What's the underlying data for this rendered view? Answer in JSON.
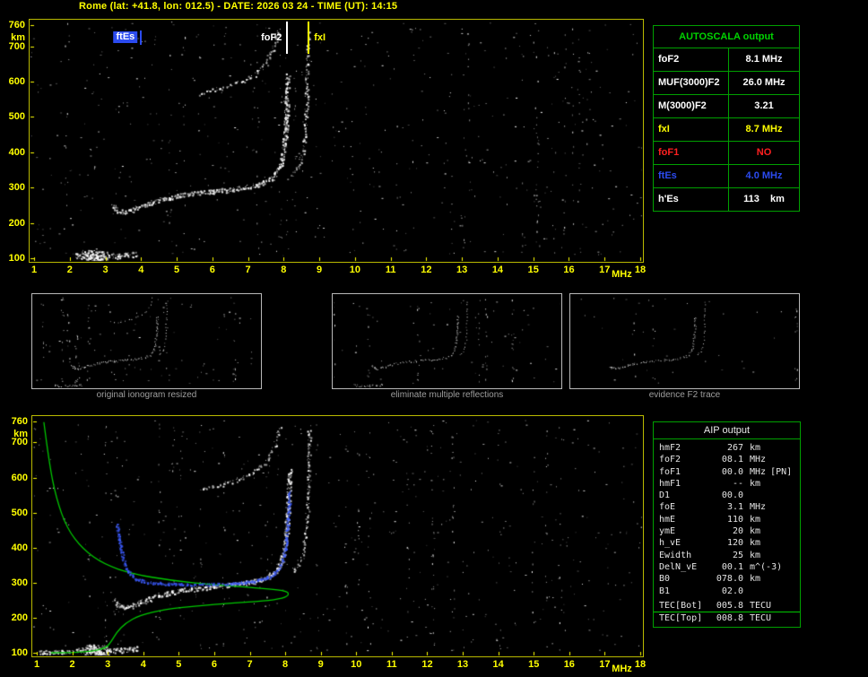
{
  "title": "Rome (lat: +41.8, lon: 012.5) - DATE: 2026 03 24 - TIME (UT): 14:15",
  "colors": {
    "axis": "#ffff00",
    "border_yellow": "#b9b900",
    "border_green": "#00a000",
    "header_green": "#00d400",
    "trace_white": "#ffffff",
    "profile_green": "#00c800",
    "restored_blue": "#3c5cff",
    "ftes_blue": "#2b4bf0",
    "fof1_red": "#ff2020",
    "fxi_yellow": "#ffff00",
    "caption_gray": "#9f9f9f"
  },
  "autoscala": {
    "header": "AUTOSCALA output",
    "rows": [
      {
        "label": "foF2",
        "value": "8.1 MHz",
        "color": "#ffffff"
      },
      {
        "label": "MUF(3000)F2",
        "value": "26.0 MHz",
        "color": "#ffffff"
      },
      {
        "label": "M(3000)F2",
        "value": "3.21",
        "color": "#ffffff"
      },
      {
        "label": "fxI",
        "value": "8.7 MHz",
        "color": "#ffff00"
      },
      {
        "label": "foF1",
        "value": "NO",
        "color": "#ff2020"
      },
      {
        "label": "ftEs",
        "value": "4.0 MHz",
        "color": "#2b4bf0"
      },
      {
        "label": "h'Es",
        "value": "113    km",
        "color": "#ffffff"
      }
    ]
  },
  "aip": {
    "header": "AIP output",
    "rows": [
      {
        "label": "hmF2",
        "value": "267",
        "unit": "km",
        "extra": ""
      },
      {
        "label": "foF2",
        "value": "08.1",
        "unit": "MHz",
        "extra": ""
      },
      {
        "label": "foF1",
        "value": "00.0",
        "unit": "MHz",
        "extra": "[PN]"
      },
      {
        "label": "hmF1",
        "value": "--",
        "unit": "km",
        "extra": ""
      },
      {
        "label": "D1",
        "value": "00.0",
        "unit": "",
        "extra": ""
      },
      {
        "label": "foE",
        "value": "3.1",
        "unit": "MHz",
        "extra": ""
      },
      {
        "label": "hmE",
        "value": "110",
        "unit": "km",
        "extra": ""
      },
      {
        "label": "ymE",
        "value": "20",
        "unit": "km",
        "extra": ""
      },
      {
        "label": "h_vE",
        "value": "120",
        "unit": "km",
        "extra": ""
      },
      {
        "label": "Ewidth",
        "value": "25",
        "unit": "km",
        "extra": ""
      },
      {
        "label": "DelN_vE",
        "value": "00.1",
        "unit": "m^(-3)",
        "extra": ""
      },
      {
        "label": "B0",
        "value": "078.0",
        "unit": "km",
        "extra": ""
      },
      {
        "label": "B1",
        "value": "02.0",
        "unit": "",
        "extra": ""
      }
    ],
    "tec_rows": [
      {
        "label": "TEC[Bot]",
        "value": "005.8",
        "unit": "TECU"
      },
      {
        "label": "TEC[Top]",
        "value": "008.8",
        "unit": "TECU"
      }
    ]
  },
  "captions": [
    "original ionogram resized",
    "eliminate multiple reflections",
    "evidence F2 trace"
  ],
  "chart_data": {
    "type": "scatter",
    "description": "Ionogram: echo virtual height (km) vs sounding frequency (MHz), with Autoscala scaled traces",
    "x_axis": {
      "label": "MHz",
      "min": 1,
      "max": 18,
      "ticks": [
        1,
        2,
        3,
        4,
        5,
        6,
        7,
        8,
        9,
        10,
        11,
        12,
        13,
        14,
        15,
        16,
        17,
        18
      ]
    },
    "y_axis": {
      "label": "km",
      "min": 100,
      "max": 760,
      "ticks": [
        760,
        700,
        600,
        500,
        400,
        300,
        200,
        100
      ]
    },
    "markers": [
      {
        "name": "ftEs",
        "label": "ftEs",
        "freq": 4.0,
        "color": "#2b4bf0",
        "text": "#ffffff",
        "filled": true,
        "side": "left"
      },
      {
        "name": "foF2",
        "label": "foF2",
        "freq": 8.1,
        "color": "#ffffff",
        "text": "#ffffff",
        "filled": false,
        "side": "left"
      },
      {
        "name": "fxI",
        "label": "fxI",
        "freq": 8.7,
        "color": "#ffff00",
        "text": "#ffff00",
        "filled": false,
        "side": "right"
      }
    ],
    "traces": {
      "es": {
        "points": [
          [
            2.15,
            110
          ],
          [
            2.45,
            106
          ],
          [
            2.75,
            104
          ],
          [
            3.05,
            106
          ],
          [
            3.35,
            108
          ],
          [
            3.6,
            110
          ],
          [
            3.85,
            113
          ]
        ],
        "jx": 2.5,
        "jy": 3,
        "passes": 2,
        "step": 1.2
      },
      "es_core": {
        "points": [
          [
            2.4,
            108
          ],
          [
            2.7,
            105
          ],
          [
            3.0,
            107
          ]
        ],
        "jx": 4,
        "jy": 7,
        "passes": 4,
        "step": 0.8
      },
      "es_low": {
        "points": [
          [
            1.1,
            103
          ],
          [
            1.55,
            103
          ],
          [
            2.0,
            104
          ]
        ],
        "jx": 2,
        "jy": 2,
        "passes": 2,
        "step": 1.2
      },
      "f2_o": {
        "points": [
          [
            3.18,
            250
          ],
          [
            3.3,
            237
          ],
          [
            3.5,
            231
          ],
          [
            3.8,
            240
          ],
          [
            4.2,
            255
          ],
          [
            4.6,
            268
          ],
          [
            5.1,
            279
          ],
          [
            5.6,
            286
          ],
          [
            6.1,
            291
          ],
          [
            6.6,
            296
          ],
          [
            7.05,
            303
          ],
          [
            7.4,
            313
          ],
          [
            7.7,
            330
          ],
          [
            7.9,
            362
          ],
          [
            8.0,
            415
          ],
          [
            8.06,
            485
          ],
          [
            8.09,
            555
          ],
          [
            8.11,
            625
          ]
        ],
        "jx": 2.5,
        "jy": 2.5,
        "passes": 2,
        "step": 1.3
      },
      "f2_x": {
        "points": [
          [
            8.22,
            335
          ],
          [
            8.4,
            358
          ],
          [
            8.5,
            390
          ],
          [
            8.58,
            445
          ],
          [
            8.62,
            510
          ],
          [
            8.64,
            585
          ],
          [
            8.66,
            670
          ],
          [
            8.67,
            748
          ]
        ],
        "jx": 2,
        "jy": 2,
        "passes": 1,
        "step": 1.5
      },
      "second_hop": {
        "points": [
          [
            5.6,
            565
          ],
          [
            6.0,
            576
          ],
          [
            6.45,
            588
          ],
          [
            6.85,
            602
          ],
          [
            7.2,
            622
          ],
          [
            7.5,
            652
          ],
          [
            7.7,
            695
          ],
          [
            7.85,
            748
          ]
        ],
        "jx": 2,
        "jy": 2,
        "passes": 1,
        "step": 1.6
      },
      "profile": {
        "points": [
          [
            1.2,
            758
          ],
          [
            1.35,
            640
          ],
          [
            1.55,
            540
          ],
          [
            1.85,
            455
          ],
          [
            2.3,
            395
          ],
          [
            2.9,
            352
          ],
          [
            3.7,
            325
          ],
          [
            4.8,
            306
          ],
          [
            6.0,
            294
          ],
          [
            7.2,
            285
          ],
          [
            8.0,
            278
          ],
          [
            8.12,
            267
          ],
          [
            7.95,
            255
          ],
          [
            7.4,
            248
          ],
          [
            6.5,
            242
          ],
          [
            5.5,
            234
          ],
          [
            4.6,
            224
          ],
          [
            3.9,
            207
          ],
          [
            3.5,
            185
          ],
          [
            3.25,
            158
          ],
          [
            3.1,
            132
          ],
          [
            2.95,
            114
          ],
          [
            2.6,
            105
          ],
          [
            2.1,
            101
          ],
          [
            1.4,
            100
          ]
        ]
      },
      "restored": {
        "points": [
          [
            3.25,
            465
          ],
          [
            3.32,
            420
          ],
          [
            3.42,
            370
          ],
          [
            3.55,
            335
          ],
          [
            3.75,
            312
          ],
          [
            4.1,
            302
          ],
          [
            4.6,
            298
          ],
          [
            5.2,
            296
          ],
          [
            5.8,
            296
          ],
          [
            6.4,
            298
          ],
          [
            7.0,
            303
          ],
          [
            7.35,
            310
          ],
          [
            7.65,
            322
          ],
          [
            7.85,
            345
          ],
          [
            7.97,
            385
          ],
          [
            8.04,
            440
          ],
          [
            8.09,
            505
          ],
          [
            8.12,
            565
          ]
        ],
        "jx": 1.5,
        "jy": 1.5,
        "passes": 2,
        "step": 1.4
      }
    },
    "plots": {
      "main": {
        "canvas": "main-canvas",
        "x_max": 18,
        "noise": 520,
        "streaks": 26,
        "traces": [
          "es",
          "es_core",
          "f2_o",
          "f2_x",
          "second_hop"
        ]
      },
      "bottom": {
        "canvas": "bottom-canvas",
        "x_max": 18,
        "noise": 480,
        "streaks": 24,
        "traces": [
          "es",
          "es_core",
          "es_low",
          "f2_o",
          "f2_x",
          "second_hop"
        ],
        "profile": "profile",
        "restored": "restored"
      },
      "thumb1": {
        "canvas": "thumb1-canvas",
        "x_max": 14,
        "noise": 90,
        "streaks": 8,
        "traces": [
          "es",
          "f2_o",
          "f2_x",
          "second_hop"
        ]
      },
      "thumb2": {
        "canvas": "thumb2-canvas",
        "x_max": 14,
        "noise": 60,
        "streaks": 6,
        "traces": [
          "es",
          "f2_o",
          "f2_x"
        ]
      },
      "thumb3": {
        "canvas": "thumb3-canvas",
        "x_max": 14,
        "noise": 30,
        "streaks": 3,
        "traces": [
          "f2_o",
          "f2_x"
        ]
      }
    }
  }
}
